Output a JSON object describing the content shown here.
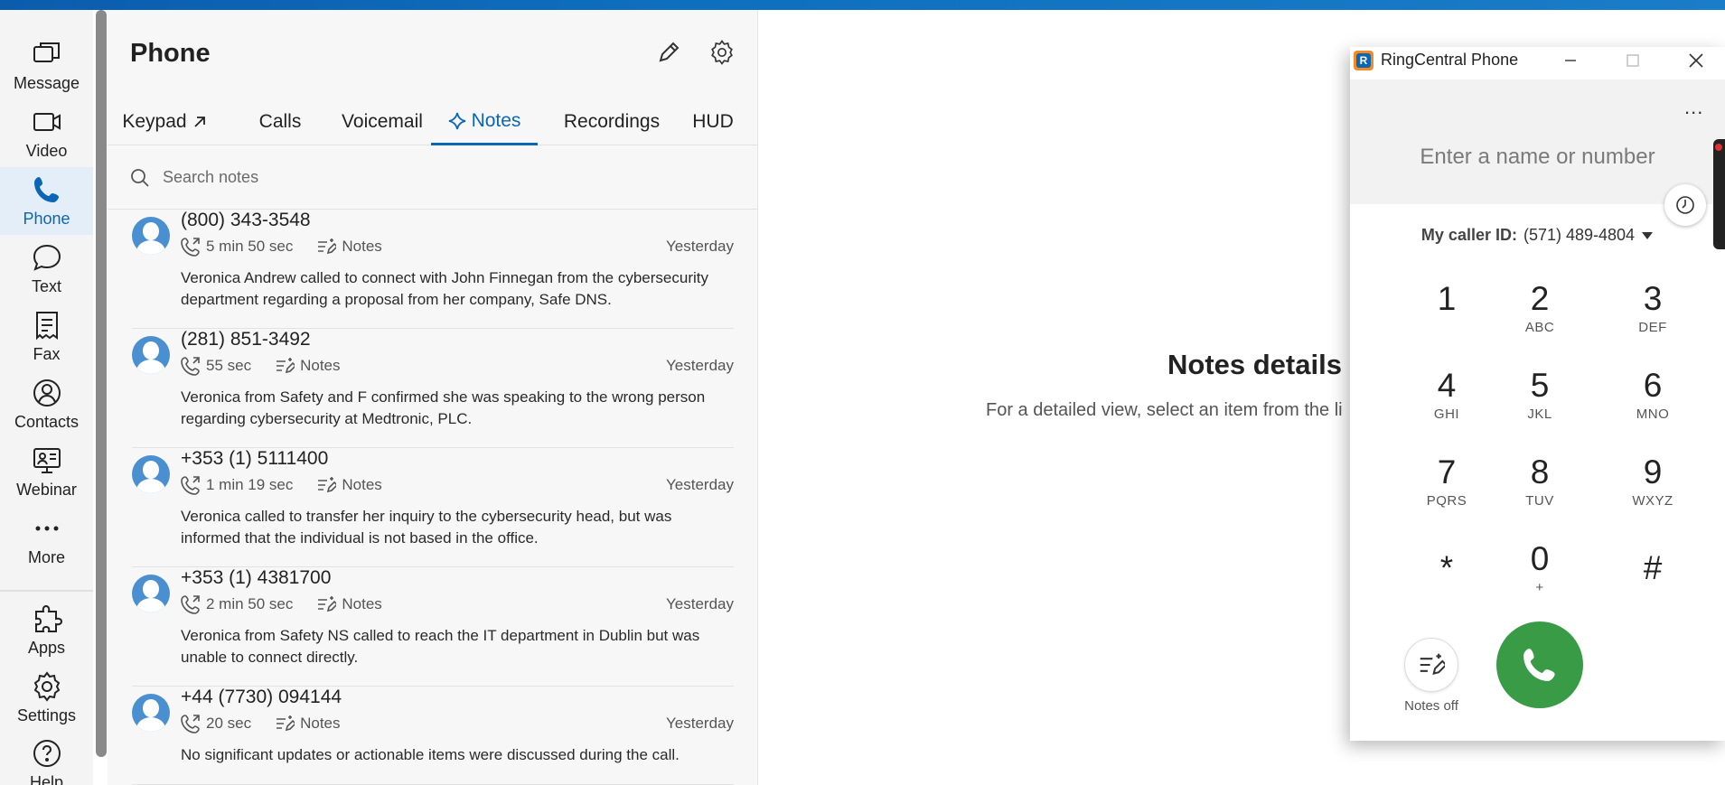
{
  "nav": {
    "items": [
      {
        "label": "Message",
        "icon": "message-icon"
      },
      {
        "label": "Video",
        "icon": "video-icon"
      },
      {
        "label": "Phone",
        "icon": "phone-icon",
        "active": true
      },
      {
        "label": "Text",
        "icon": "text-bubble-icon"
      },
      {
        "label": "Fax",
        "icon": "fax-icon"
      },
      {
        "label": "Contacts",
        "icon": "contacts-icon"
      },
      {
        "label": "Webinar",
        "icon": "webinar-icon"
      },
      {
        "label": "More",
        "icon": "more-dots-icon"
      },
      {
        "label": "Apps",
        "icon": "puzzle-icon"
      },
      {
        "label": "Settings",
        "icon": "gear-icon"
      },
      {
        "label": "Help",
        "icon": "help-icon"
      }
    ]
  },
  "panel": {
    "title": "Phone",
    "tabs": [
      "Keypad",
      "Calls",
      "Voicemail",
      "Notes",
      "Recordings",
      "HUD"
    ],
    "active_tab": "Notes",
    "search_placeholder": "Search notes",
    "notes_label": "Notes",
    "items": [
      {
        "number": "(800) 343-3548",
        "duration": "5 min 50 sec",
        "when": "Yesterday",
        "text": "Veronica Andrew called to connect with John Finnegan from the cybersecurity department regarding a proposal from her company, Safe DNS."
      },
      {
        "number": "(281) 851-3492",
        "duration": "55 sec",
        "when": "Yesterday",
        "text": "Veronica from Safety and F confirmed she was speaking to the wrong person regarding cybersecurity at Medtronic, PLC."
      },
      {
        "number": "+353 (1) 5111400",
        "duration": "1 min 19 sec",
        "when": "Yesterday",
        "text": "Veronica called to transfer her inquiry to the cybersecurity head, but was informed that the individual is not based in the office."
      },
      {
        "number": "+353 (1) 4381700",
        "duration": "2 min 50 sec",
        "when": "Yesterday",
        "text": "Veronica from Safety NS called to reach the IT department in Dublin but was unable to connect directly."
      },
      {
        "number": "+44 (7730) 094144",
        "duration": "20 sec",
        "when": "Yesterday",
        "text": "No significant updates or actionable items were discussed during the call."
      }
    ]
  },
  "details": {
    "title": "Notes details",
    "subtitle": "For a detailed view, select an item from the li"
  },
  "softphone": {
    "title": "RingCentral Phone",
    "more": "...",
    "placeholder": "Enter a name or number",
    "callerid_label": "My caller ID:",
    "callerid_value": "(571) 489-4804",
    "keys": [
      {
        "d": "1",
        "l": ""
      },
      {
        "d": "2",
        "l": "ABC"
      },
      {
        "d": "3",
        "l": "DEF"
      },
      {
        "d": "4",
        "l": "GHI"
      },
      {
        "d": "5",
        "l": "JKL"
      },
      {
        "d": "6",
        "l": "MNO"
      },
      {
        "d": "7",
        "l": "PQRS"
      },
      {
        "d": "8",
        "l": "TUV"
      },
      {
        "d": "9",
        "l": "WXYZ"
      },
      {
        "d": "*",
        "l": ""
      },
      {
        "d": "0",
        "l": "+"
      },
      {
        "d": "#",
        "l": ""
      }
    ],
    "notes_off": "Notes off"
  },
  "colors": {
    "accent": "#0b66b5",
    "call_green": "#3a9b47",
    "logo_orange": "#f38a24"
  }
}
